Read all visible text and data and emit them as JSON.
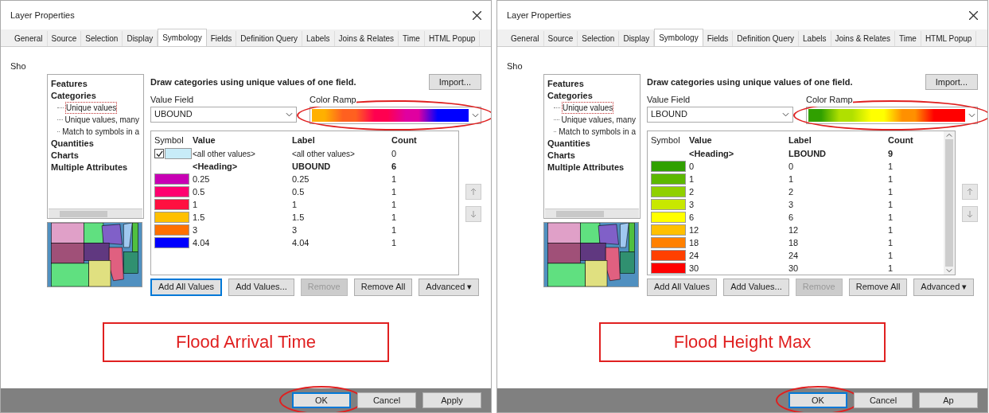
{
  "dialogs": [
    {
      "title": "Layer Properties",
      "tabs": [
        {
          "label": "General",
          "selected": false
        },
        {
          "label": "Source",
          "selected": false
        },
        {
          "label": "Selection",
          "selected": false
        },
        {
          "label": "Display",
          "selected": false
        },
        {
          "label": "Symbology",
          "selected": true
        },
        {
          "label": "Fields",
          "selected": false
        },
        {
          "label": "Definition Query",
          "selected": false
        },
        {
          "label": "Labels",
          "selected": false
        },
        {
          "label": "Joins & Relates",
          "selected": false
        },
        {
          "label": "Time",
          "selected": false
        },
        {
          "label": "HTML Popup",
          "selected": false
        }
      ],
      "show_label": "Sho",
      "tree": [
        {
          "label": "Features",
          "selected": false
        },
        {
          "label": "Categories",
          "selected": false,
          "children": [
            {
              "label": "Unique values",
              "selected": true
            },
            {
              "label": "Unique values, many",
              "selected": false
            },
            {
              "label": "Match to symbols in a",
              "selected": false
            }
          ]
        },
        {
          "label": "Quantities",
          "selected": false
        },
        {
          "label": "Charts",
          "selected": false
        },
        {
          "label": "Multiple Attributes",
          "selected": false
        }
      ],
      "heading": "Draw categories using unique values of one field.",
      "import_button": "Import...",
      "value_field": {
        "label": "Value Field",
        "value": "UBOUND"
      },
      "color_ramp": {
        "label": "Color Ramp",
        "stops": [
          {
            "color": "#ffb000"
          },
          {
            "color": "#ff6020"
          },
          {
            "color": "#ff0050"
          },
          {
            "color": "#e000a0"
          },
          {
            "color": "#0000ff"
          }
        ],
        "circled": true
      },
      "table": {
        "columns": [
          "Symbol",
          "Value",
          "Label",
          "Count"
        ],
        "scrollable": false,
        "rows": [
          {
            "kind": "other",
            "checked": true,
            "color": "#c8ecf8",
            "value": "<all other values>",
            "label": "<all other values>",
            "count": "0"
          },
          {
            "kind": "heading",
            "value": "<Heading>",
            "label": "UBOUND",
            "count": "6"
          },
          {
            "kind": "value",
            "color": "#c800b4",
            "value": "0.25",
            "label": "0.25",
            "count": "1"
          },
          {
            "kind": "value",
            "color": "#ff0070",
            "value": "0.5",
            "label": "0.5",
            "count": "1"
          },
          {
            "kind": "value",
            "color": "#ff1040",
            "value": "1",
            "label": "1",
            "count": "1"
          },
          {
            "kind": "value",
            "color": "#ffc000",
            "value": "1.5",
            "label": "1.5",
            "count": "1"
          },
          {
            "kind": "value",
            "color": "#ff7000",
            "value": "3",
            "label": "3",
            "count": "1"
          },
          {
            "kind": "value",
            "color": "#0000ff",
            "value": "4.04",
            "label": "4.04",
            "count": "1"
          }
        ]
      },
      "buttons": [
        {
          "label": "Add All Values",
          "disabled": false,
          "focused": true
        },
        {
          "label": "Add Values...",
          "disabled": false,
          "focused": false
        },
        {
          "label": "Remove",
          "disabled": true,
          "focused": false
        },
        {
          "label": "Remove All",
          "disabled": false,
          "focused": false
        },
        {
          "label": "Advanced ▾",
          "disabled": false,
          "focused": false
        }
      ],
      "caption": "Flood Arrival Time",
      "footer": [
        {
          "label": "OK",
          "default": true,
          "circled": true
        },
        {
          "label": "Cancel",
          "default": false,
          "circled": false
        },
        {
          "label": "Apply",
          "default": false,
          "circled": false
        }
      ]
    },
    {
      "title": "Layer Properties",
      "tabs": [
        {
          "label": "General",
          "selected": false
        },
        {
          "label": "Source",
          "selected": false
        },
        {
          "label": "Selection",
          "selected": false
        },
        {
          "label": "Display",
          "selected": false
        },
        {
          "label": "Symbology",
          "selected": true
        },
        {
          "label": "Fields",
          "selected": false
        },
        {
          "label": "Definition Query",
          "selected": false
        },
        {
          "label": "Labels",
          "selected": false
        },
        {
          "label": "Joins & Relates",
          "selected": false
        },
        {
          "label": "Time",
          "selected": false
        },
        {
          "label": "HTML Popup",
          "selected": false
        }
      ],
      "show_label": "Sho",
      "tree": [
        {
          "label": "Features",
          "selected": false
        },
        {
          "label": "Categories",
          "selected": false,
          "children": [
            {
              "label": "Unique values",
              "selected": true
            },
            {
              "label": "Unique values, many",
              "selected": false
            },
            {
              "label": "Match to symbols in a",
              "selected": false
            }
          ]
        },
        {
          "label": "Quantities",
          "selected": false
        },
        {
          "label": "Charts",
          "selected": false
        },
        {
          "label": "Multiple Attributes",
          "selected": false
        }
      ],
      "heading": "Draw categories using unique values of one field.",
      "import_button": "Import...",
      "value_field": {
        "label": "Value Field",
        "value": "LBOUND"
      },
      "color_ramp": {
        "label": "Color Ramp",
        "stops": [
          {
            "color": "#30a000"
          },
          {
            "color": "#b0e000"
          },
          {
            "color": "#ffff00"
          },
          {
            "color": "#ff9000"
          },
          {
            "color": "#ff0000"
          }
        ],
        "circled": true
      },
      "table": {
        "columns": [
          "Symbol",
          "Value",
          "Label",
          "Count"
        ],
        "scrollable": true,
        "rows": [
          {
            "kind": "heading",
            "value": "<Heading>",
            "label": "LBOUND",
            "count": "9"
          },
          {
            "kind": "value",
            "color": "#30a000",
            "value": "0",
            "label": "0",
            "count": "1"
          },
          {
            "kind": "value",
            "color": "#5cb800",
            "value": "1",
            "label": "1",
            "count": "1"
          },
          {
            "kind": "value",
            "color": "#90d000",
            "value": "2",
            "label": "2",
            "count": "1"
          },
          {
            "kind": "value",
            "color": "#c8e800",
            "value": "3",
            "label": "3",
            "count": "1"
          },
          {
            "kind": "value",
            "color": "#ffff00",
            "value": "6",
            "label": "6",
            "count": "1"
          },
          {
            "kind": "value",
            "color": "#ffc000",
            "value": "12",
            "label": "12",
            "count": "1"
          },
          {
            "kind": "value",
            "color": "#ff8000",
            "value": "18",
            "label": "18",
            "count": "1"
          },
          {
            "kind": "value",
            "color": "#ff4000",
            "value": "24",
            "label": "24",
            "count": "1"
          },
          {
            "kind": "value",
            "color": "#ff0000",
            "value": "30",
            "label": "30",
            "count": "1"
          }
        ]
      },
      "buttons": [
        {
          "label": "Add All Values",
          "disabled": false,
          "focused": false
        },
        {
          "label": "Add Values...",
          "disabled": false,
          "focused": false
        },
        {
          "label": "Remove",
          "disabled": true,
          "focused": false
        },
        {
          "label": "Remove All",
          "disabled": false,
          "focused": false
        },
        {
          "label": "Advanced ▾",
          "disabled": false,
          "focused": false
        }
      ],
      "caption": "Flood Height Max",
      "footer": [
        {
          "label": "OK",
          "default": true,
          "circled": true
        },
        {
          "label": "Cancel",
          "default": false,
          "circled": false
        },
        {
          "label": "Ap",
          "default": false,
          "circled": false
        }
      ]
    }
  ]
}
